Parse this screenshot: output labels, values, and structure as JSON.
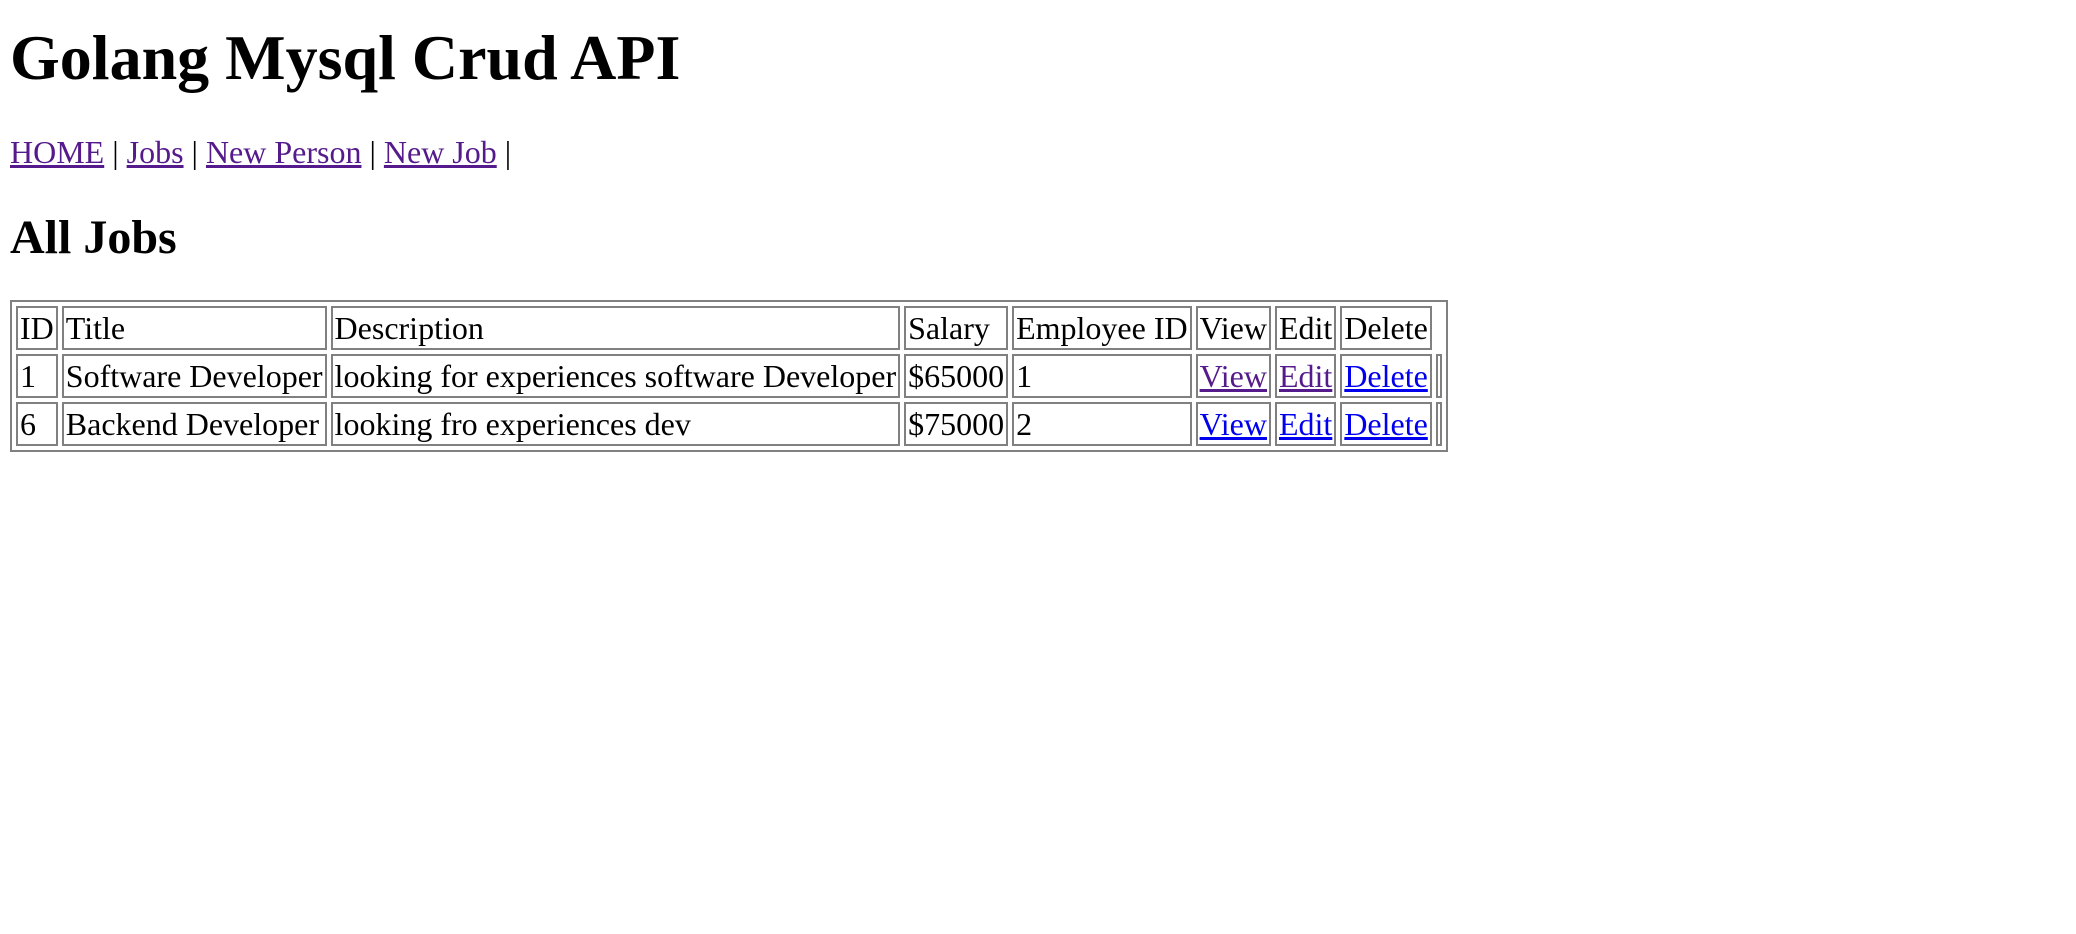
{
  "header": {
    "title": "Golang Mysql Crud API"
  },
  "nav": {
    "items": [
      {
        "label": "HOME",
        "visited": true
      },
      {
        "label": "Jobs",
        "visited": true
      },
      {
        "label": "New Person",
        "visited": true
      },
      {
        "label": "New Job",
        "visited": true
      }
    ],
    "separator": "|"
  },
  "main": {
    "heading": "All Jobs",
    "table": {
      "headers": [
        "ID",
        "Title",
        "Description",
        "Salary",
        "Employee ID",
        "View",
        "Edit",
        "Delete"
      ],
      "rows": [
        {
          "id": "1",
          "title": "Software Developer",
          "description": "looking for experiences software Developer",
          "salary": "$65000",
          "employee_id": "1",
          "view": "View",
          "edit": "Edit",
          "delete": "Delete"
        },
        {
          "id": "6",
          "title": "Backend Developer",
          "description": "looking fro experiences dev",
          "salary": "$75000",
          "employee_id": "2",
          "view": "View",
          "edit": "Edit",
          "delete": "Delete"
        }
      ]
    }
  },
  "colors": {
    "link_visited": "#551a8b",
    "link_unvisited": "#0000ee",
    "table_border": "#808080"
  }
}
